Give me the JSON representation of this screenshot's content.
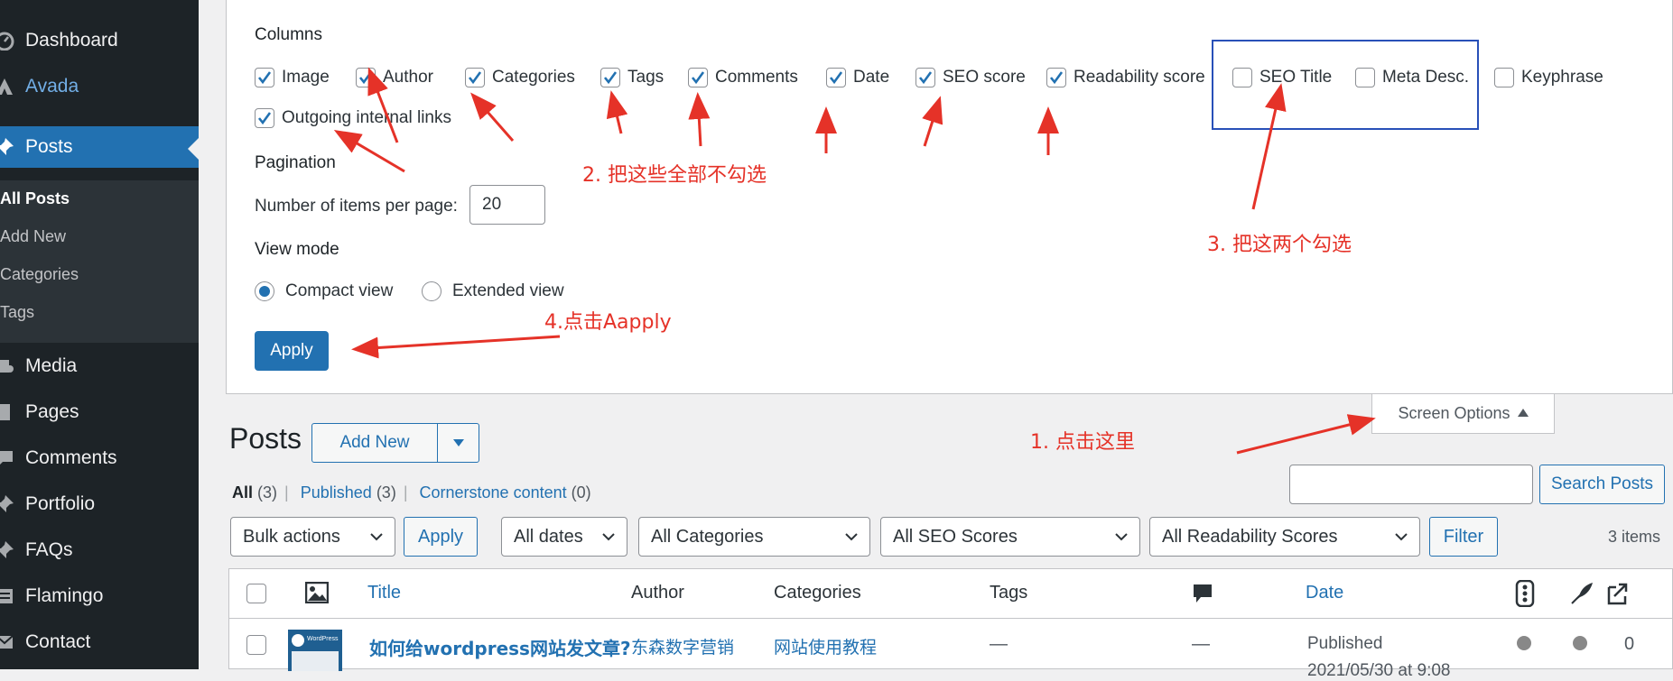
{
  "sidebar": {
    "items": [
      {
        "label": "Dashboard",
        "icon": "dashboard-icon"
      },
      {
        "label": "Avada",
        "icon": "avada-icon"
      },
      {
        "label": "Posts",
        "icon": "pin-icon"
      },
      {
        "label": "Media",
        "icon": "media-icon"
      },
      {
        "label": "Pages",
        "icon": "pages-icon"
      },
      {
        "label": "Comments",
        "icon": "comments-icon"
      },
      {
        "label": "Portfolio",
        "icon": "pin-icon"
      },
      {
        "label": "FAQs",
        "icon": "pin-icon"
      },
      {
        "label": "Flamingo",
        "icon": "flamingo-icon"
      },
      {
        "label": "Contact",
        "icon": "mail-icon"
      }
    ],
    "submenu": [
      "All Posts",
      "Add New",
      "Categories",
      "Tags"
    ]
  },
  "screen_options": {
    "columns_heading": "Columns",
    "columns": [
      {
        "label": "Image",
        "checked": true
      },
      {
        "label": "Author",
        "checked": true
      },
      {
        "label": "Categories",
        "checked": true
      },
      {
        "label": "Tags",
        "checked": true
      },
      {
        "label": "Comments",
        "checked": true
      },
      {
        "label": "Date",
        "checked": true
      },
      {
        "label": "SEO score",
        "checked": true
      },
      {
        "label": "Readability score",
        "checked": true
      },
      {
        "label": "SEO Title",
        "checked": false
      },
      {
        "label": "Meta Desc.",
        "checked": false
      },
      {
        "label": "Keyphrase",
        "checked": false
      },
      {
        "label": "Outgoing internal links",
        "checked": true
      }
    ],
    "pagination_heading": "Pagination",
    "per_page_label": "Number of items per page:",
    "per_page_value": "20",
    "view_mode_heading": "View mode",
    "view_modes": [
      {
        "label": "Compact view",
        "selected": true
      },
      {
        "label": "Extended view",
        "selected": false
      }
    ],
    "apply_label": "Apply",
    "toggle_label": "Screen Options"
  },
  "annotations": {
    "step1": "1. 点击这里",
    "step2": "2. 把这些全部不勾选",
    "step3": "3. 把这两个勾选",
    "step4": "4.点击Aapply"
  },
  "page": {
    "title": "Posts",
    "add_new_label": "Add New"
  },
  "views": {
    "all": {
      "label": "All",
      "count": "(3)"
    },
    "published": {
      "label": "Published",
      "count": "(3)"
    },
    "cornerstone": {
      "label": "Cornerstone content",
      "count": "(0)"
    }
  },
  "search": {
    "value": "",
    "button_label": "Search Posts"
  },
  "filters": {
    "bulk_actions": "Bulk actions",
    "apply_label": "Apply",
    "dates": "All dates",
    "categories": "All Categories",
    "seo_scores": "All SEO Scores",
    "readability_scores": "All Readability Scores",
    "filter_label": "Filter",
    "items_count": "3 items"
  },
  "table": {
    "headers": {
      "image_icon": "image-icon",
      "title": "Title",
      "author": "Author",
      "categories": "Categories",
      "tags": "Tags",
      "comments_icon": "comment-bubble-icon",
      "date": "Date",
      "seo_icon": "seo-traffic-light-icon",
      "readability_icon": "readability-quill-icon",
      "links_icon": "outgoing-links-icon"
    },
    "rows": [
      {
        "thumbnail_text": "WordPress",
        "title": "如何给wordpress网站发文章?",
        "author": "东森数字营销",
        "categories": "网站使用教程",
        "tags": "—",
        "comments": "—",
        "date_status": "Published",
        "date_value": "2021/05/30 at 9:08",
        "links": "0"
      }
    ]
  },
  "colors": {
    "wp_blue": "#2271b1",
    "sidebar_bg": "#1d2327",
    "annotation_red": "#e53228",
    "annotation_box": "#2850b8"
  }
}
